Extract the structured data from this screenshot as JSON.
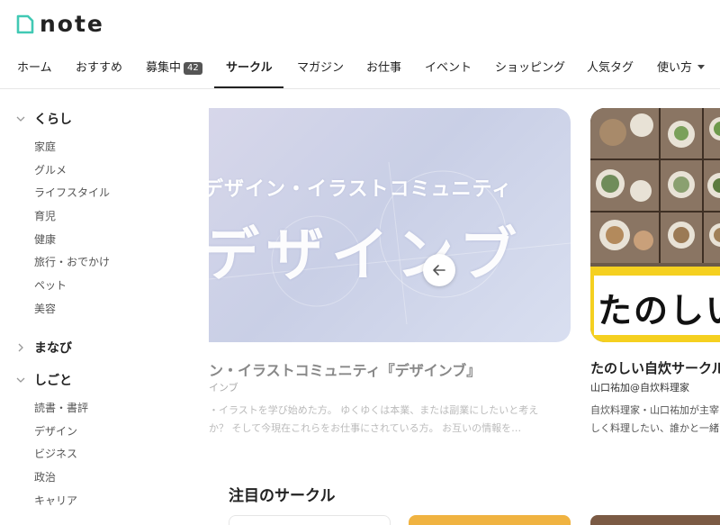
{
  "brand": {
    "name": "note"
  },
  "nav": {
    "tabs": [
      {
        "label": "ホーム"
      },
      {
        "label": "おすすめ"
      },
      {
        "label": "募集中",
        "badge": "42"
      },
      {
        "label": "サークル",
        "active": true
      },
      {
        "label": "マガジン"
      },
      {
        "label": "お仕事"
      },
      {
        "label": "イベント"
      },
      {
        "label": "ショッピング"
      },
      {
        "label": "人気タグ"
      },
      {
        "label": "使い方",
        "dropdown": true
      }
    ]
  },
  "sidebar": {
    "categories": [
      {
        "label": "くらし",
        "expanded": true,
        "items": [
          "家庭",
          "グルメ",
          "ライフスタイル",
          "育児",
          "健康",
          "旅行・おでかけ",
          "ペット",
          "美容"
        ]
      },
      {
        "label": "まなび",
        "expanded": false,
        "items": []
      },
      {
        "label": "しごと",
        "expanded": true,
        "items": [
          "読書・書評",
          "デザイン",
          "ビジネス",
          "政治",
          "キャリア"
        ]
      }
    ]
  },
  "carousel": {
    "card1": {
      "image_sub": "デザイン・イラストコミュニティ",
      "image_big": "デザインブ",
      "title": "ン・イラストコミュニティ『デザインブ』",
      "author": "インブ",
      "desc_line1": "・イラストを学び始めた方。 ゆくゆくは本業、または副業にしたいと考え",
      "desc_line2": "か？ そして今現在これらをお仕事にされている方。 お互いの情報を…"
    },
    "card2": {
      "image_big": "たのしい",
      "title": "たのしい自炊サークル",
      "author": "山口祐加@自炊料理家",
      "desc_line1": "自炊料理家・山口祐加が主宰",
      "desc_line2": "しく料理したい、誰かと一緒に"
    },
    "prev_icon": "arrow-left-icon"
  },
  "featured": {
    "title": "注目のサークル"
  },
  "colors": {
    "accent_yellow": "#f5d020",
    "brand_green": "#41c9b4"
  }
}
